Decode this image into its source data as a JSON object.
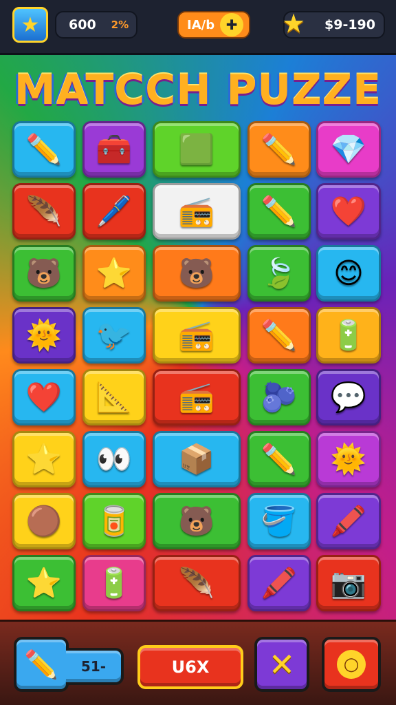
{
  "hud": {
    "coins": "600",
    "percent": "2%",
    "center_label": "IA/b",
    "center_icon": "puzzle-icon",
    "money": "$9-190"
  },
  "title": "MATCCH PUZZE",
  "board": {
    "tiles": [
      {
        "icon": "pencil-icon",
        "glyph": "✏️",
        "color": "#27b7f0"
      },
      {
        "icon": "toolbox-icon",
        "glyph": "🧰",
        "color": "#9a3ad6"
      },
      {
        "icon": "green-box-icon",
        "glyph": "🟩",
        "color": "#5fd32a"
      },
      {
        "icon": "pencil-icon",
        "glyph": "✏️",
        "color": "#ff8c1a"
      },
      {
        "icon": "diamond-icon",
        "glyph": "💎",
        "color": "#e83cc8"
      },
      {
        "icon": "feather-icon",
        "glyph": "🪶",
        "color": "#e8331e"
      },
      {
        "icon": "marker-icon",
        "glyph": "🖊️",
        "color": "#e8331e"
      },
      {
        "icon": "radio-icon",
        "glyph": "📻",
        "color": "#f2f2f2"
      },
      {
        "icon": "pencil-icon",
        "glyph": "✏️",
        "color": "#3cbf34"
      },
      {
        "icon": "heart-icon",
        "glyph": "❤️",
        "color": "#7d3ad6"
      },
      {
        "icon": "bear-icon",
        "glyph": "🐻",
        "color": "#3cbf34"
      },
      {
        "icon": "star-icon",
        "glyph": "⭐",
        "color": "#ff8c1a"
      },
      {
        "icon": "bear-icon",
        "glyph": "🐻",
        "color": "#ff7a1a"
      },
      {
        "icon": "leaf-icon",
        "glyph": "🍃",
        "color": "#3cbf34"
      },
      {
        "icon": "smiley-icon",
        "glyph": "😊",
        "color": "#27b7f0"
      },
      {
        "icon": "sun-icon",
        "glyph": "🌞",
        "color": "#6a32c8"
      },
      {
        "icon": "bird-icon",
        "glyph": "🐦",
        "color": "#27b7f0"
      },
      {
        "icon": "radio-icon",
        "glyph": "📻",
        "color": "#ffd21a"
      },
      {
        "icon": "pencil-icon",
        "glyph": "✏️",
        "color": "#ff7a1a"
      },
      {
        "icon": "battery-icon",
        "glyph": "🔋",
        "color": "#ffb21a"
      },
      {
        "icon": "heart-icon",
        "glyph": "❤️",
        "color": "#27b7f0"
      },
      {
        "icon": "paper-plane-icon",
        "glyph": "📐",
        "color": "#ffd21a"
      },
      {
        "icon": "radio-icon",
        "glyph": "📻",
        "color": "#e8331e"
      },
      {
        "icon": "berry-icon",
        "glyph": "🫐",
        "color": "#3cbf34"
      },
      {
        "icon": "chat-heart-icon",
        "glyph": "💬",
        "color": "#6a32c8"
      },
      {
        "icon": "star-icon",
        "glyph": "⭐",
        "color": "#ffd21a"
      },
      {
        "icon": "eyes-icon",
        "glyph": "👀",
        "color": "#27b7f0"
      },
      {
        "icon": "orange-box-icon",
        "glyph": "📦",
        "color": "#27b7f0"
      },
      {
        "icon": "pencil-icon",
        "glyph": "✏️",
        "color": "#3cbf34"
      },
      {
        "icon": "sun-icon",
        "glyph": "🌞",
        "color": "#b93ad6"
      },
      {
        "icon": "blob-icon",
        "glyph": "🟤",
        "color": "#ffd21a"
      },
      {
        "icon": "can-icon",
        "glyph": "🥫",
        "color": "#5fd32a"
      },
      {
        "icon": "bear-icon",
        "glyph": "🐻",
        "color": "#3cbf34"
      },
      {
        "icon": "paint-bucket-icon",
        "glyph": "🪣",
        "color": "#27b7f0"
      },
      {
        "icon": "marker-icon",
        "glyph": "🖍️",
        "color": "#7d3ad6"
      },
      {
        "icon": "star-icon",
        "glyph": "⭐",
        "color": "#3cbf34"
      },
      {
        "icon": "battery-icon",
        "glyph": "🔋",
        "color": "#e83c8c"
      },
      {
        "icon": "feather-icon",
        "glyph": "🪶",
        "color": "#e8331e"
      },
      {
        "icon": "marker-icon",
        "glyph": "🖍️",
        "color": "#7d3ad6"
      },
      {
        "icon": "camera-icon",
        "glyph": "📷",
        "color": "#e8331e"
      }
    ]
  },
  "bottom": {
    "moves": "51-",
    "action_label": "U6X",
    "cancel_icon": "close-icon",
    "search_icon": "search-icon",
    "tool_icon": "pencil-icon"
  },
  "colors": {
    "hud_bg": "#1d2230",
    "accent_orange": "#ff8c1a",
    "gold": "#ffd42a",
    "action_red": "#e8331e"
  }
}
